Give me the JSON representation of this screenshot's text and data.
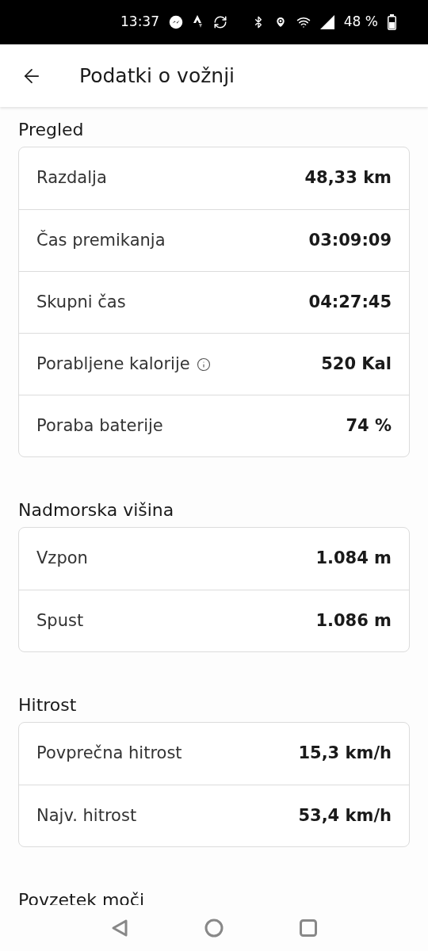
{
  "status_bar": {
    "time": "13:37",
    "battery": "48 %"
  },
  "header": {
    "title": "Podatki o vožnji"
  },
  "sections": [
    {
      "title": "Pregled",
      "rows": [
        {
          "label": "Razdalja",
          "value": "48,33 km"
        },
        {
          "label": "Čas premikanja",
          "value": "03:09:09"
        },
        {
          "label": "Skupni čas",
          "value": "04:27:45"
        },
        {
          "label": "Porabljene kalorije",
          "value": "520 Kal",
          "info": true
        },
        {
          "label": "Poraba baterije",
          "value": "74 %"
        }
      ]
    },
    {
      "title": "Nadmorska višina",
      "rows": [
        {
          "label": "Vzpon",
          "value": "1.084 m"
        },
        {
          "label": "Spust",
          "value": "1.086 m"
        }
      ]
    },
    {
      "title": "Hitrost",
      "rows": [
        {
          "label": "Povprečna hitrost",
          "value": "15,3 km/h"
        },
        {
          "label": "Najv. hitrost",
          "value": "53,4 km/h"
        }
      ]
    },
    {
      "title": "Povzetek moči"
    }
  ]
}
